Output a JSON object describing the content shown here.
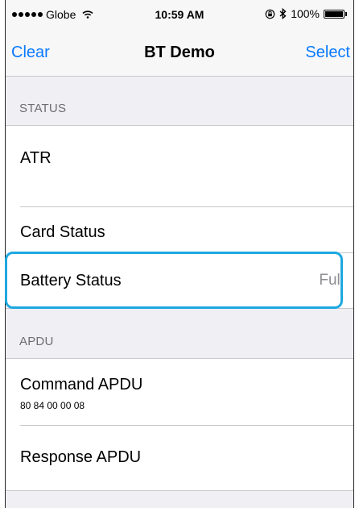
{
  "status_bar": {
    "carrier": "Globe",
    "time": "10:59 AM",
    "battery_percent": "100%"
  },
  "nav": {
    "left_button": "Clear",
    "title": "BT Demo",
    "right_button": "Select"
  },
  "sections": {
    "status": {
      "header": "STATUS",
      "atr_label": "ATR",
      "card_status_label": "Card Status",
      "battery_status_label": "Battery Status",
      "battery_status_value": "Full"
    },
    "apdu": {
      "header": "APDU",
      "command_label": "Command APDU",
      "command_value": "80 84 00 00 08",
      "response_label": "Response APDU"
    }
  },
  "colors": {
    "accent": "#0a7aff",
    "highlight_outline": "#1ea8e0",
    "background": "#efeff4"
  }
}
